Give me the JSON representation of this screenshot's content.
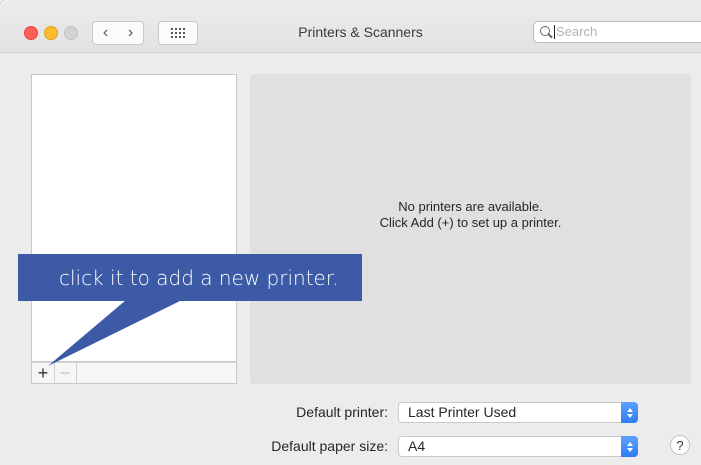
{
  "window": {
    "title": "Printers & Scanners"
  },
  "toolbar": {
    "back_icon": "chevron-left",
    "forward_icon": "chevron-right",
    "grid_icon": "grid-dots",
    "search_placeholder": "Search"
  },
  "printer_list": {
    "add_label": "+",
    "remove_label": "−"
  },
  "detail": {
    "empty_line1": "No printers are available.",
    "empty_line2": "Click Add (+) to set up a printer."
  },
  "settings": {
    "default_printer_label": "Default printer:",
    "default_printer_value": "Last Printer Used",
    "default_paper_label": "Default paper size:",
    "default_paper_value": "A4",
    "help_label": "?"
  },
  "callout": {
    "text": "click it to add a new printer.",
    "color": "#3d5aa6"
  }
}
